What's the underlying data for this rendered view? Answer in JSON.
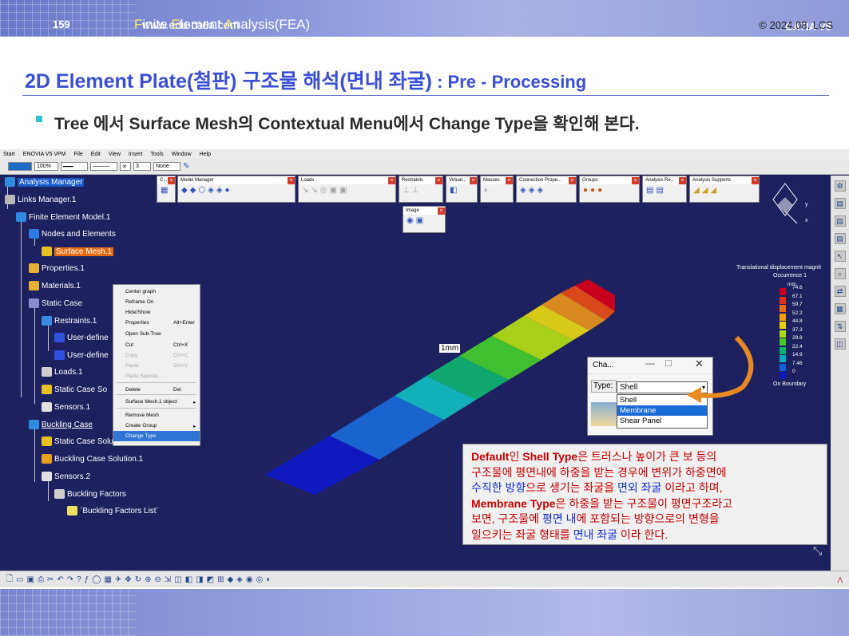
{
  "header": {
    "course_title_parts": [
      "F",
      "inite ",
      "E",
      "lement ",
      "A",
      "nalysis(FEA)"
    ],
    "brand": "CATIA V5"
  },
  "slide": {
    "title_main": "2D Element Plate(철판) 구조물 해석(면내 좌굴)",
    "title_suffix": " : Pre - Processing",
    "bullet": "Tree 에서 Surface Mesh의 Contextual Menu에서 Change Type을 확인해 본다."
  },
  "catia": {
    "menu": [
      "Start",
      "ENOVIA V5 VPM",
      "File",
      "Edit",
      "View",
      "Insert",
      "Tools",
      "Window",
      "Help"
    ],
    "toolbar": {
      "zoom": "100%",
      "count": "3",
      "none": "None"
    },
    "tree": [
      {
        "label": "Analysis Manager",
        "selected": true
      },
      {
        "label": "Links Manager.1"
      },
      {
        "label": "Finite Element Model.1"
      },
      {
        "label": "Nodes and Elements"
      },
      {
        "label": "Surface Mesh.1",
        "highlight": true
      },
      {
        "label": "Properties.1"
      },
      {
        "label": "Materials.1"
      },
      {
        "label": "Static Case"
      },
      {
        "label": "Restraints.1"
      },
      {
        "label": "User-define"
      },
      {
        "label": "User-define"
      },
      {
        "label": "Loads.1"
      },
      {
        "label": "Static Case So"
      },
      {
        "label": "Sensors.1"
      },
      {
        "label": "Buckling Case",
        "underline": true
      },
      {
        "label": "Static Case Solution.1"
      },
      {
        "label": "Buckling Case Solution.1"
      },
      {
        "label": "Sensors.2"
      },
      {
        "label": "Buckling Factors"
      },
      {
        "label": "`Buckling Factors List`"
      }
    ],
    "toolbars": [
      "C...",
      "Model Manager",
      "Loads",
      "Restraints",
      "Virtual...",
      "Masses",
      "Connection Prope...",
      "Groups",
      "Analysis Re...",
      "Analysis Supports",
      "Image"
    ],
    "context_menu": [
      {
        "label": "Center graph",
        "shortcut": ""
      },
      {
        "label": "Reframe On",
        "shortcut": ""
      },
      {
        "label": "Hide/Show",
        "shortcut": ""
      },
      {
        "label": "Properties",
        "shortcut": "Alt+Enter"
      },
      {
        "label": "Open Sub-Tree",
        "shortcut": ""
      },
      {
        "label": "Cut",
        "shortcut": "Ctrl+X"
      },
      {
        "label": "Copy",
        "shortcut": "Ctrl+C",
        "disabled": true
      },
      {
        "label": "Paste",
        "shortcut": "Ctrl+V",
        "disabled": true
      },
      {
        "label": "Paste Special...",
        "shortcut": "",
        "disabled": true
      },
      {
        "label": "Delete",
        "shortcut": "Del"
      },
      {
        "label": "Surface Mesh.1 object",
        "shortcut": "▸"
      },
      {
        "label": "Remove Mesh",
        "shortcut": ""
      },
      {
        "label": "Create Group",
        "shortcut": "▸"
      },
      {
        "label": "Change Type",
        "shortcut": "",
        "selected": true
      }
    ],
    "plate_label": "1mm",
    "legend": {
      "title": "Translational displacement magnit",
      "occurrence": "Occurrence 1",
      "unit": "mm",
      "values": [
        "74.6",
        "67.1",
        "59.7",
        "52.2",
        "44.8",
        "37.3",
        "29.8",
        "22.4",
        "14.9",
        "7.46",
        "0"
      ],
      "colors": [
        "#c8001e",
        "#e0301a",
        "#ee6a16",
        "#f4a010",
        "#e8d010",
        "#a8d818",
        "#48c828",
        "#10b070",
        "#10a8c0",
        "#1060d0",
        "#1018c0"
      ],
      "footer": "On Boundary"
    },
    "axis_labels": {
      "y": "y",
      "x": "x"
    },
    "type_dialog": {
      "title": "Cha...",
      "field_label": "Type:",
      "value": "Shell",
      "options": [
        "Shell",
        "Membrane",
        "Shear Panel"
      ],
      "highlighted_option": "Membrane"
    }
  },
  "explanation": {
    "lines": [
      [
        {
          "t": "Default",
          "c": "r",
          "b": true
        },
        {
          "t": "인 ",
          "c": "r"
        },
        {
          "t": "Shell Type",
          "c": "r",
          "b": true
        },
        {
          "t": "은 트러스나 높이가 큰 보 등의",
          "c": "r"
        }
      ],
      [
        {
          "t": "구조물에 평면내에 하중을 받는 경우에 변위가 하중면에",
          "c": "r"
        }
      ],
      [
        {
          "t": "수직한 방향",
          "c": "b"
        },
        {
          "t": "으로 생기는 좌굴을 ",
          "c": "r"
        },
        {
          "t": "면외 좌굴",
          "c": "b"
        },
        {
          "t": " 이라고 하며,",
          "c": "r"
        }
      ],
      [
        {
          "t": "Membrane Type",
          "c": "r",
          "b": true
        },
        {
          "t": "은 하중을 받는 구조물이 평면구조라고",
          "c": "r"
        }
      ],
      [
        {
          "t": "보면, 구조물에 ",
          "c": "r"
        },
        {
          "t": "평면 내",
          "c": "b"
        },
        {
          "t": "에 포함되는 방향으로의 변형을",
          "c": "r"
        }
      ],
      [
        {
          "t": "일으키는 좌굴 형태를 ",
          "c": "r"
        },
        {
          "t": "면내 좌굴",
          "c": "b"
        },
        {
          "t": " 이라 한다.",
          "c": "r"
        }
      ]
    ]
  },
  "footer": {
    "page": "159",
    "site": "www.edu-catia.com",
    "copyright": "© 2024.08. LCS"
  }
}
